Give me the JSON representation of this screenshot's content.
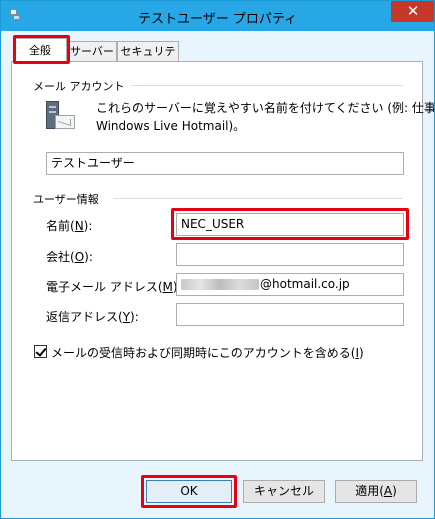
{
  "window": {
    "title": "テストユーザー プロパティ",
    "close_glyph": "✕"
  },
  "tabs": [
    {
      "label": "全般",
      "active": true
    },
    {
      "label": "サーバー",
      "active": false
    },
    {
      "label": "セキュリティ",
      "active": false
    }
  ],
  "mail_account": {
    "group_label": "メール アカウント",
    "description_line1": "これらのサーバーに覚えやすい名前を付けてください (例: 仕事、",
    "description_line2": "Windows Live Hotmail)。",
    "account_name_value": "テストユーザー"
  },
  "user_info": {
    "group_label": "ユーザー情報",
    "name_label": "名前(",
    "name_key": "N",
    "name_label_end": "):",
    "name_value": "NEC_USER",
    "company_label": "会社(",
    "company_key": "O",
    "company_label_end": "):",
    "company_value": "",
    "email_label": "電子メール アドレス(",
    "email_key": "M",
    "email_label_end": "):",
    "email_value_suffix": "@hotmail.co.jp",
    "reply_label": "返信アドレス(",
    "reply_key": "Y",
    "reply_label_end": "):",
    "reply_value": ""
  },
  "sync_option": {
    "label": "メールの受信時および同期時にこのアカウントを含める(",
    "key": "I",
    "label_end": ")",
    "checked": true
  },
  "buttons": {
    "ok": "OK",
    "cancel": "キャンセル",
    "apply": "適用(",
    "apply_key": "A",
    "apply_end": ")"
  },
  "colors": {
    "titlebar": "#28a7e6",
    "highlight": "#e60012",
    "close_button": "#c7382b"
  }
}
